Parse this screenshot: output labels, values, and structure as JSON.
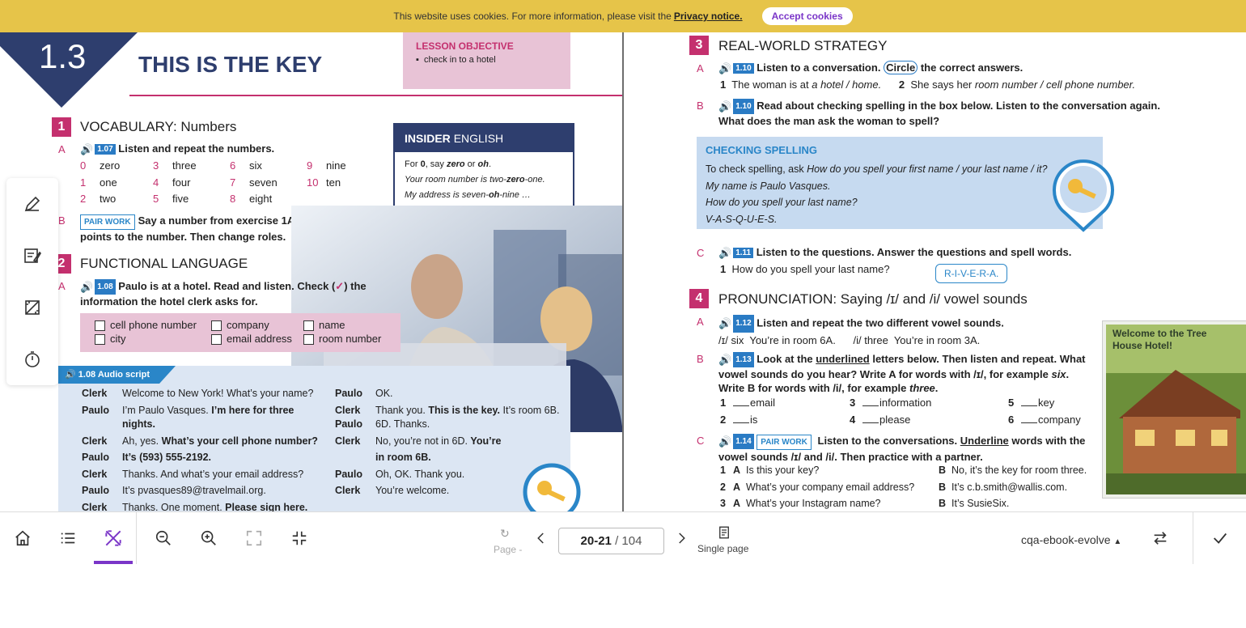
{
  "cookie": {
    "text": "This website uses cookies. For more information, please visit the",
    "link": "Privacy notice.",
    "accept": "Accept cookies"
  },
  "left": {
    "unit": "1.3",
    "title": "THIS IS THE KEY",
    "objective": {
      "heading": "LESSON OBJECTIVE",
      "item": "check in to a hotel"
    },
    "s1": {
      "num": "1",
      "title": "VOCABULARY: Numbers"
    },
    "s1A": {
      "letter": "A",
      "audio": "1.07",
      "text": "Listen and repeat the numbers."
    },
    "numbers": [
      {
        "n": "0",
        "w": "zero"
      },
      {
        "n": "3",
        "w": "three"
      },
      {
        "n": "6",
        "w": "six"
      },
      {
        "n": "9",
        "w": "nine"
      },
      {
        "n": "1",
        "w": "one"
      },
      {
        "n": "4",
        "w": "four"
      },
      {
        "n": "7",
        "w": "seven"
      },
      {
        "n": "10",
        "w": "ten"
      },
      {
        "n": "2",
        "w": "two"
      },
      {
        "n": "5",
        "w": "five"
      },
      {
        "n": "8",
        "w": "eight"
      }
    ],
    "s1B": {
      "letter": "B",
      "tag": "PAIR WORK",
      "text1": "Say a number from exercise 1A. Your partner",
      "text2": "points to the number. Then change roles."
    },
    "insider": {
      "h1": "INSIDER",
      "h2": "ENGLISH",
      "l1a": "For",
      "l1b": "0",
      "l1c": ", say",
      "l1d": "zero",
      "l1e": "or",
      "l1f": "oh",
      "l1g": ".",
      "l2a": "Your room number is two-",
      "l2b": "zero",
      "l2c": "-one.",
      "l3a": "My address is seven-",
      "l3b": "oh",
      "l3c": "-nine …"
    },
    "s2": {
      "num": "2",
      "title": "FUNCTIONAL LANGUAGE"
    },
    "s2A": {
      "letter": "A",
      "audio": "1.08",
      "text1": "Paulo is at a hotel. Read and listen. Check (",
      "check": "✓",
      "text2": ") the",
      "text3": "information the hotel clerk asks for."
    },
    "checks": [
      "cell phone number",
      "company",
      "name",
      "city",
      "email address",
      "room number"
    ],
    "script": {
      "title": "1.08 Audio script",
      "left": [
        {
          "sp": "Clerk",
          "t": "Welcome to New York! What’s your name?",
          "b": ""
        },
        {
          "sp": "Paulo",
          "t": "I’m Paulo Vasques.",
          "b": "I’m here for three"
        },
        {
          "sp": "",
          "t": "",
          "b": "nights."
        },
        {
          "sp": "Clerk",
          "t": "Ah, yes.",
          "b": "What’s your cell phone number?"
        },
        {
          "sp": "Paulo",
          "t": "",
          "b": "It’s (593) 555-2192."
        },
        {
          "sp": "Clerk",
          "t": "Thanks. And what’s your email address?",
          "b": ""
        },
        {
          "sp": "Paulo",
          "t": "It’s pvasques89@travelmail.org.",
          "b": ""
        },
        {
          "sp": "Clerk",
          "t": "Thanks. One moment.",
          "b": "Please sign here."
        }
      ],
      "right": [
        {
          "sp": "Paulo",
          "t": "OK.",
          "b": "",
          "t2": ""
        },
        {
          "sp": "Clerk",
          "t": "Thank you.",
          "b": "This is the key.",
          "t2": "It’s room 6B."
        },
        {
          "sp": "Paulo",
          "t": "6D. Thanks.",
          "b": "",
          "t2": ""
        },
        {
          "sp": "Clerk",
          "t": "No, you’re not in 6D.",
          "b": "You’re",
          "t2": ""
        },
        {
          "sp": "",
          "t": "",
          "b": "in room 6B.",
          "t2": ""
        },
        {
          "sp": "Paulo",
          "t": "Oh, OK. Thank you.",
          "b": "",
          "t2": ""
        },
        {
          "sp": "Clerk",
          "t": "You’re welcome.",
          "b": "",
          "t2": ""
        }
      ]
    }
  },
  "right": {
    "s3": {
      "num": "3",
      "title": "REAL-WORLD STRATEGY"
    },
    "s3A": {
      "letter": "A",
      "audio": "1.10",
      "t1": "Listen to a conversation.",
      "circle": "Circle",
      "t2": "the correct answers."
    },
    "s3Aq": {
      "n1": "1",
      "q1a": "The woman is at",
      "q1b": "a hotel / home.",
      "n2": "2",
      "q2a": "She says her",
      "q2b": "room number / cell phone number."
    },
    "s3B": {
      "letter": "B",
      "audio": "1.10",
      "t1": "Read about checking spelling in the box below. Listen to the conversation again.",
      "t2": "What does the man ask the woman to spell?"
    },
    "checking": {
      "title": "CHECKING SPELLING",
      "l1a": "To check spelling, ask",
      "l1b": "How do you spell your first name / your last name / it?",
      "l2": "My name is Paulo Vasques.",
      "l3": "How do you spell your last name?",
      "l4": "V-A-S-Q-U-E-S."
    },
    "s3C": {
      "letter": "C",
      "audio": "1.11",
      "t": "Listen to the questions. Answer the questions and spell words.",
      "n": "1",
      "q": "How do you spell your last name?",
      "answer": "R-I-V-E-R-A."
    },
    "s4": {
      "num": "4",
      "title": "PRONUNCIATION: Saying /ɪ/ and /i/ vowel sounds"
    },
    "s4A": {
      "letter": "A",
      "audio": "1.12",
      "t": "Listen and repeat the two different vowel sounds.",
      "l2": "/ɪ/ six  You’re in room 6A.      /i/ three  You’re in room 3A."
    },
    "s4B": {
      "letter": "B",
      "audio": "1.13",
      "t1a": "Look at the",
      "t1u": "underlined",
      "t1b": "letters below. Then listen and repeat. What",
      "t2a": "vowel sounds do you hear? Write A for words with /ɪ/, for example",
      "t2i": "six",
      "t2b": ".",
      "t3a": "Write B for words with /i/, for example",
      "t3i": "three",
      "t3b": "."
    },
    "words": [
      {
        "n": "1",
        "w": "email"
      },
      {
        "n": "3",
        "w": "information"
      },
      {
        "n": "5",
        "w": "key"
      },
      {
        "n": "2",
        "w": "is"
      },
      {
        "n": "4",
        "w": "please"
      },
      {
        "n": "6",
        "w": "company"
      }
    ],
    "s4C": {
      "letter": "C",
      "audio": "1.14",
      "tag": "PAIR WORK",
      "t1a": "Listen to the conversations.",
      "t1u": "Underline",
      "t1b": "words with the",
      "t2": "vowel sounds /ɪ/ and /i/. Then practice with a partner."
    },
    "convo": [
      {
        "n": "1",
        "a": "Is this your key?",
        "b": "No, it’s the key for room three."
      },
      {
        "n": "2",
        "a": "What’s your company email address?",
        "b": "It’s c.b.smith@wallis.com."
      },
      {
        "n": "3",
        "a": "What’s your Instagram name?",
        "b": "It’s SusieSix."
      }
    ],
    "hotel": "Welcome to the Tree House Hotel!"
  },
  "toolbar": {
    "page_label": "Page -",
    "page_value": "20-21",
    "page_total": "/ 104",
    "single_page": "Single page",
    "book": "cqa-ebook-evolve"
  },
  "sidebar": [
    "pen-icon",
    "note-icon",
    "crop-icon",
    "timer-icon"
  ],
  "colors": {
    "magenta": "#c4306e",
    "blue": "#2a7bc4",
    "navy": "#2e3e6e",
    "accent": "#7a35c8",
    "cookie": "#e6c449"
  }
}
